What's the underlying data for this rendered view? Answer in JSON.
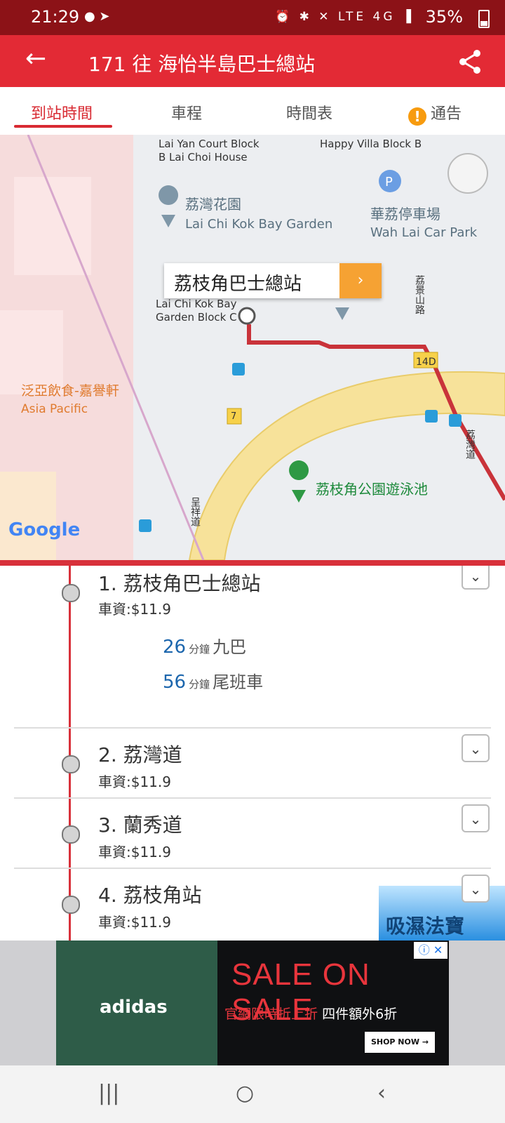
{
  "status": {
    "time": "21:29",
    "left_icons": "● ➤",
    "right_icons": "⏰ ✱ ✕ LTE 4G ▐",
    "battery": "35%"
  },
  "appbar": {
    "back_icon": "arrow-left-icon",
    "title": "171 往 海怡半島巴士總站",
    "share_icon": "share-icon"
  },
  "tabs": [
    {
      "label": "到站時間",
      "active": true
    },
    {
      "label": "車程",
      "active": false
    },
    {
      "label": "時間表",
      "active": false
    },
    {
      "label": "通告",
      "active": false
    }
  ],
  "map": {
    "labels": {
      "lai_yan_court": "Lai Yan Court Block\nB Lai Choi House",
      "happy_villa": "Happy Villa Block B",
      "garden_zh": "荔灣花園",
      "garden_en": "Lai Chi Kok Bay Garden",
      "carpark_zh": "華荔停車場",
      "carpark_en": "Wah Lai Car Park",
      "garden_block_c": "Lai Chi Kok Bay\nGarden Block C",
      "road_14d": "14D",
      "road_7": "7",
      "asia_pacific_zh": "泛亞飲食-嘉譽軒",
      "asia_pacific_en": "Asia Pacific",
      "pool": "荔枝角公園遊泳池",
      "street_lai_king": "荔景山路",
      "street_lai_wan": "荔灣道",
      "street_ching_cheung": "呈祥道"
    },
    "callout_stop": "荔枝角巴士總站",
    "callout_button": "›",
    "google": "Google"
  },
  "stops": [
    {
      "name": "1. 荔枝角巴士總站",
      "fare": "車資:$11.9",
      "etas": [
        {
          "minutes": "26",
          "unit": "分鐘",
          "note": "九巴"
        },
        {
          "minutes": "56",
          "unit": "分鐘",
          "note": "尾班車"
        }
      ]
    },
    {
      "name": "2. 荔灣道",
      "fare": "車資:$11.9"
    },
    {
      "name": "3. 蘭秀道",
      "fare": "車資:$11.9"
    },
    {
      "name": "4. 荔枝角站",
      "fare": "車資:$11.9"
    }
  ],
  "float_ad": {
    "text": "吸濕法寶"
  },
  "ad": {
    "brand": "adidas",
    "headline": "SALE ON SALE",
    "subline_red": "官網限時折上折",
    "subline_white": "四件額外6折",
    "cta": "SHOP NOW →",
    "close": "ⓘ ✕"
  },
  "navbar": {
    "recent": "|||",
    "home": "○",
    "back": "‹"
  },
  "colors": {
    "primary": "#e32a35",
    "status": "#8c1217",
    "route": "#d8303a",
    "eta": "#1c66ad",
    "alert": "#f79b0f"
  }
}
